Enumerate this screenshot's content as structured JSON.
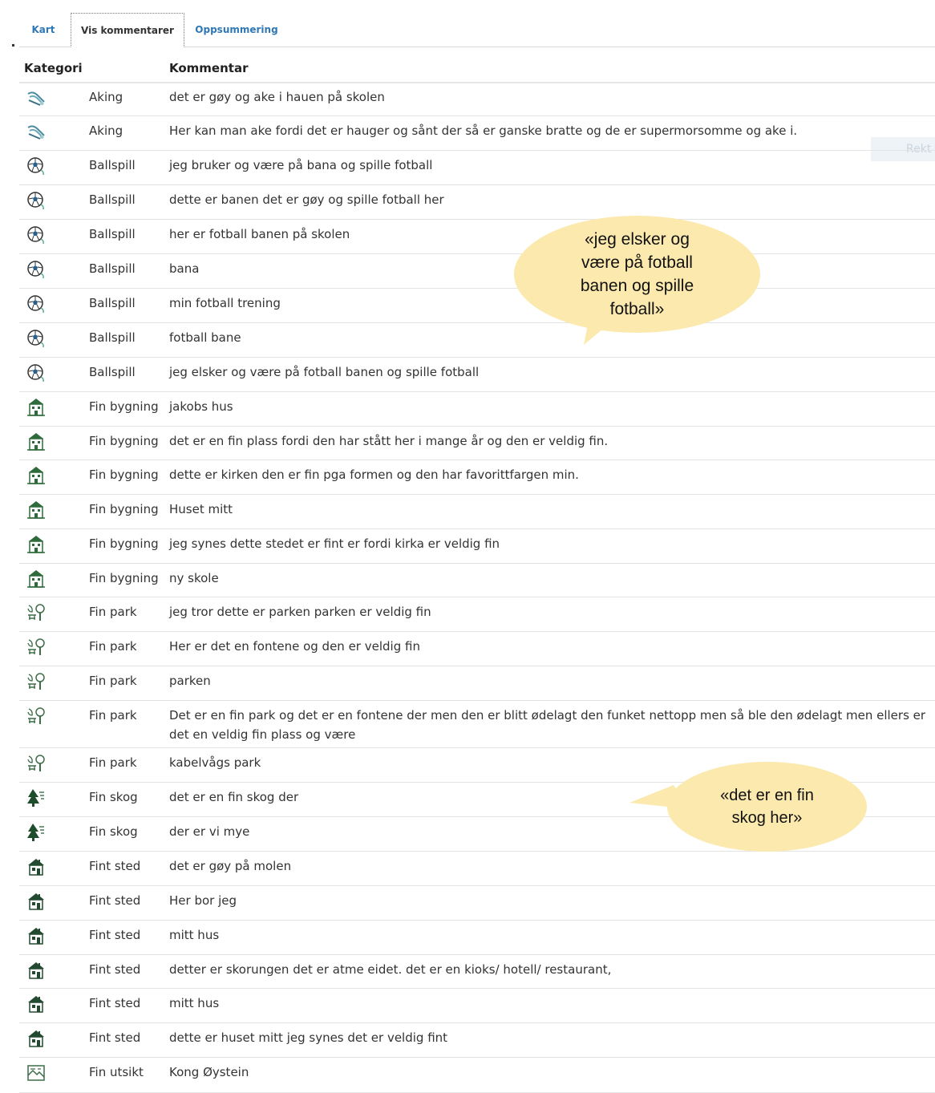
{
  "tabs": [
    "Kart",
    "Vis kommentarer",
    "Oppsummering"
  ],
  "columns": {
    "category": "Kategori",
    "comment": "Kommentar"
  },
  "rows": [
    {
      "category": "Aking",
      "icon": "sled-icon",
      "comment": "det er gøy og ake i hauen på skolen"
    },
    {
      "category": "Aking",
      "icon": "sled-icon",
      "comment": "Her kan man ake fordi det er hauger og sånt der så er ganske bratte og de er supermorsomme og ake i."
    },
    {
      "category": "Ballspill",
      "icon": "football-icon",
      "comment": "jeg bruker og være på bana og spille fotball"
    },
    {
      "category": "Ballspill",
      "icon": "football-icon",
      "comment": "dette er banen det er gøy og spille fotball her"
    },
    {
      "category": "Ballspill",
      "icon": "football-icon",
      "comment": "her er fotball banen på skolen"
    },
    {
      "category": "Ballspill",
      "icon": "football-icon",
      "comment": "bana"
    },
    {
      "category": "Ballspill",
      "icon": "football-icon",
      "comment": "min fotball trening"
    },
    {
      "category": "Ballspill",
      "icon": "football-icon",
      "comment": "fotball bane"
    },
    {
      "category": "Ballspill",
      "icon": "football-icon",
      "comment": "jeg elsker og være på fotball banen og spille fotball"
    },
    {
      "category": "Fin bygning",
      "icon": "building-icon",
      "comment": "jakobs hus"
    },
    {
      "category": "Fin bygning",
      "icon": "building-icon",
      "comment": "det er en fin plass fordi den har stått her i mange år og den er veldig fin."
    },
    {
      "category": "Fin bygning",
      "icon": "building-icon",
      "comment": "dette er kirken den er fin pga formen og den har favorittfargen min."
    },
    {
      "category": "Fin bygning",
      "icon": "building-icon",
      "comment": "Huset mitt"
    },
    {
      "category": "Fin bygning",
      "icon": "building-icon",
      "comment": "jeg synes dette stedet er fint er fordi kirka er veldig fin"
    },
    {
      "category": "Fin bygning",
      "icon": "building-icon",
      "comment": "ny skole"
    },
    {
      "category": "Fin park",
      "icon": "park-icon",
      "comment": "jeg tror dette er parken parken er veldig fin"
    },
    {
      "category": "Fin park",
      "icon": "park-icon",
      "comment": "Her er det en fontene og den er veldig fin"
    },
    {
      "category": "Fin park",
      "icon": "park-icon",
      "comment": "parken"
    },
    {
      "category": "Fin park",
      "icon": "park-icon",
      "comment": "Det er en fin park og det er en fontene der men den er blitt ødelagt den funket nettopp men så ble den ødelagt men ellers er det en veldig fin plass og være"
    },
    {
      "category": "Fin park",
      "icon": "park-icon",
      "comment": "kabelvågs park"
    },
    {
      "category": "Fin skog",
      "icon": "forest-icon",
      "comment": "det er en fin skog der"
    },
    {
      "category": "Fin skog",
      "icon": "forest-icon",
      "comment": "der er vi mye"
    },
    {
      "category": "Fint sted",
      "icon": "house-icon",
      "comment": "det er gøy på molen"
    },
    {
      "category": "Fint sted",
      "icon": "house-icon",
      "comment": "Her bor jeg"
    },
    {
      "category": "Fint sted",
      "icon": "house-icon",
      "comment": "mitt hus"
    },
    {
      "category": "Fint sted",
      "icon": "house-icon",
      "comment": "detter er skorungen det er atme eidet. det er en kioks/ hotell/ restaurant,"
    },
    {
      "category": "Fint sted",
      "icon": "house-icon",
      "comment": "mitt hus"
    },
    {
      "category": "Fint sted",
      "icon": "house-icon",
      "comment": "dette er huset mitt jeg synes det er veldig fint"
    },
    {
      "category": "Fin utsikt",
      "icon": "view-icon",
      "comment": "Kong Øystein"
    }
  ],
  "callouts": [
    {
      "lines": [
        "«jeg elsker og",
        "være på fotball",
        "banen og spille",
        "fotball»"
      ]
    },
    {
      "lines": [
        "«det er en fin",
        "skog her»"
      ]
    }
  ],
  "ghost_button": {
    "label": "Rekt"
  }
}
